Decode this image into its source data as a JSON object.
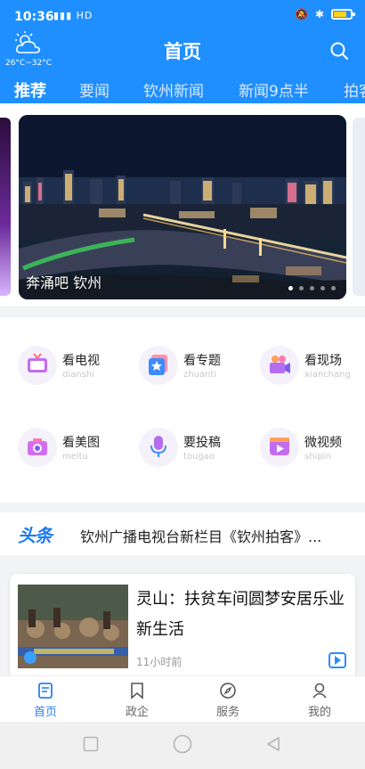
{
  "status_bar": {
    "time": "10:36",
    "signal": "HD"
  },
  "header": {
    "weather_temp": "26°C~32°C",
    "title": "首页"
  },
  "tabs": [
    "推荐",
    "要闻",
    "钦州新闻",
    "新闻9点半",
    "拍客"
  ],
  "banner": {
    "caption": "奔涌吧 钦州",
    "dot_count": 5,
    "active_dot": 0
  },
  "grid": [
    {
      "label": "看电视",
      "sub": "dianshi",
      "icon": "tv-icon"
    },
    {
      "label": "看专题",
      "sub": "zhuanti",
      "icon": "topic-star-icon"
    },
    {
      "label": "看现场",
      "sub": "xianchang",
      "icon": "camera-icon"
    },
    {
      "label": "看美图",
      "sub": "meitu",
      "icon": "photo-camera-icon"
    },
    {
      "label": "要投稿",
      "sub": "tougao",
      "icon": "microphone-icon"
    },
    {
      "label": "微视频",
      "sub": "shipin",
      "icon": "video-play-icon"
    }
  ],
  "headline": {
    "logo": "头条",
    "text": "钦州广播电视台新栏目《钦州拍客》..."
  },
  "news": [
    {
      "title": "灵山：扶贫车间圆梦安居乐业新生活",
      "time": "11小时前"
    }
  ],
  "bottom_nav": [
    {
      "label": "首页",
      "icon": "home-doc-icon"
    },
    {
      "label": "政企",
      "icon": "bookmark-icon"
    },
    {
      "label": "服务",
      "icon": "compass-icon"
    },
    {
      "label": "我的",
      "icon": "user-icon"
    }
  ],
  "colors": {
    "brand_blue": "#1f8fff",
    "active_nav": "#2b7ff2",
    "accent_purple": "#b46cf0"
  }
}
